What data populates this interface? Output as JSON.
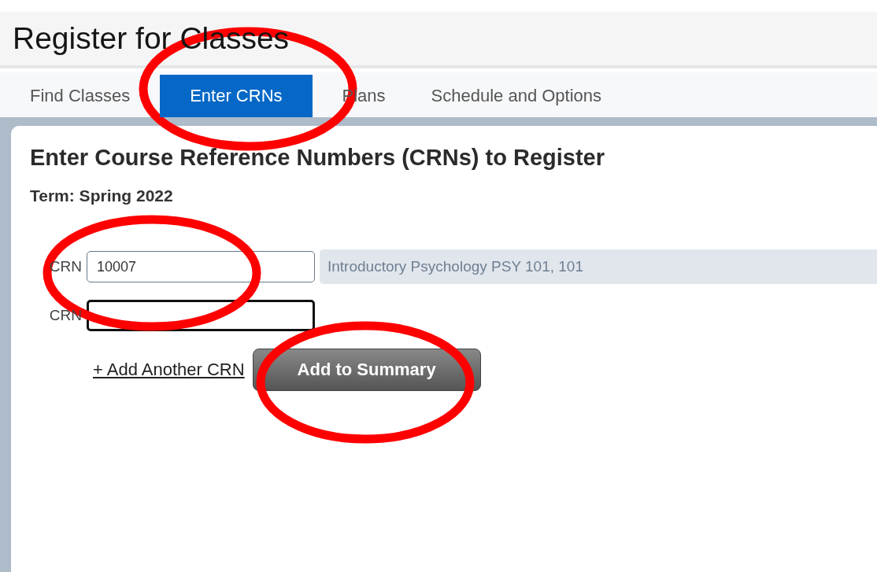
{
  "page_title": "Register for Classes",
  "tabs": [
    {
      "label": "Find Classes",
      "selected": false
    },
    {
      "label": "Enter CRNs",
      "selected": true
    },
    {
      "label": "Plans",
      "selected": false
    },
    {
      "label": "Schedule and Options",
      "selected": false
    }
  ],
  "panel": {
    "heading": "Enter Course Reference Numbers (CRNs) to Register",
    "term": "Term: Spring 2022",
    "crn_rows": [
      {
        "label": "CRN",
        "value": "10007",
        "focused": false,
        "course": "Introductory Psychology PSY 101, 101"
      },
      {
        "label": "CRN",
        "value": "",
        "focused": true
      }
    ],
    "add_link": "+ Add Another CRN",
    "submit_button": "Add to Summary"
  }
}
